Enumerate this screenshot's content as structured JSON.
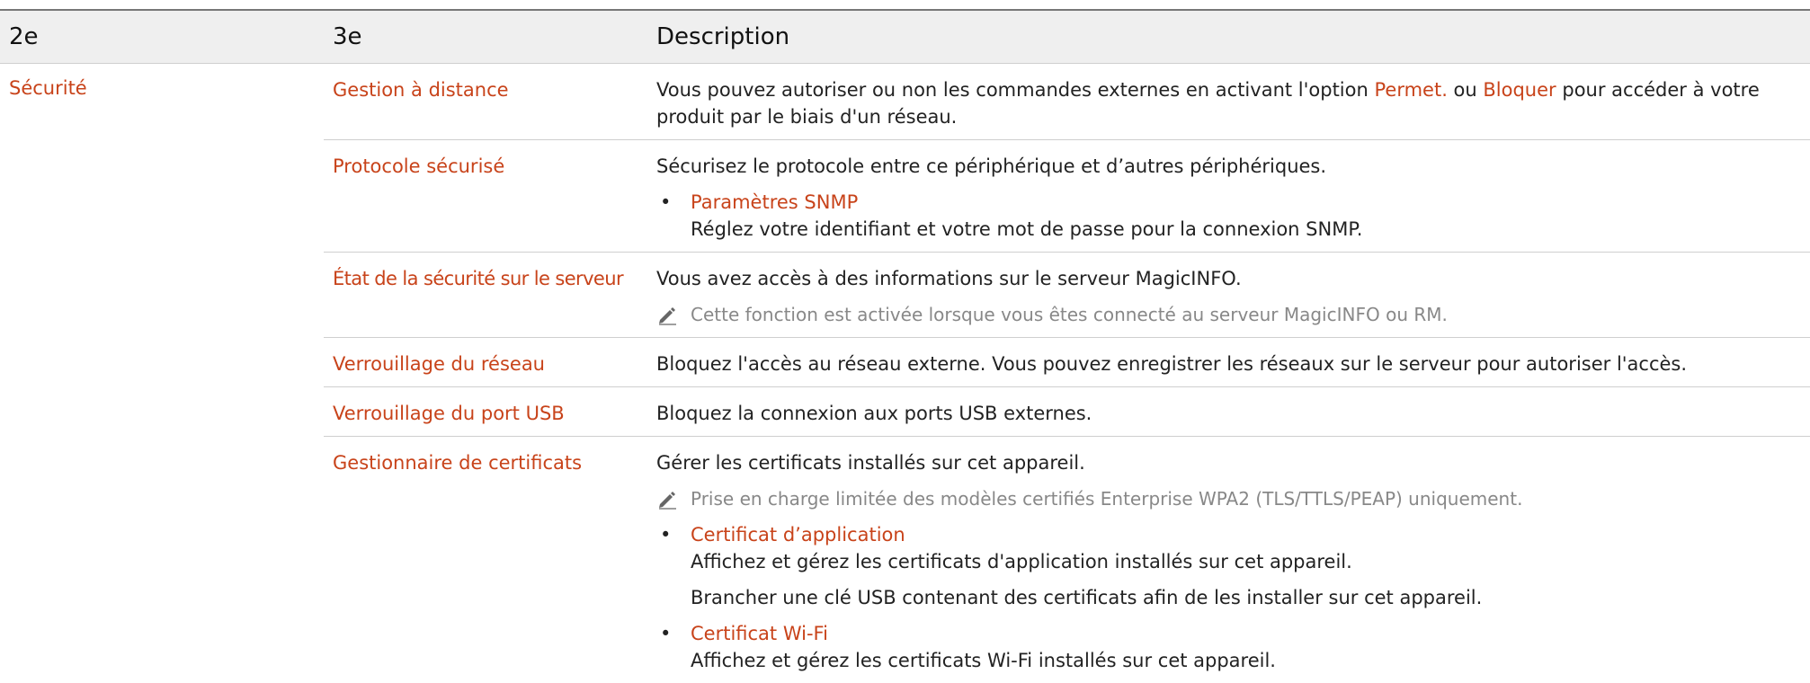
{
  "header": {
    "col1": "2e",
    "col2": "3e",
    "col3": "Description"
  },
  "category": "Sécurité",
  "rows": [
    {
      "name": "Gestion à distance",
      "desc_part1": "Vous pouvez autoriser ou non les commandes externes en activant l'option ",
      "hl1": "Permet.",
      "desc_part2": " ou ",
      "hl2": "Bloquer",
      "desc_part3": " pour accéder à votre produit par le biais d'un réseau."
    },
    {
      "name": "Protocole sécurisé",
      "desc": "Sécurisez le protocole entre ce périphérique et d’autres périphériques.",
      "bullet_title": "Paramètres SNMP",
      "bullet_desc": "Réglez votre identifiant et votre mot de passe pour la connexion SNMP."
    },
    {
      "name": "État de la sécurité sur le serveur",
      "desc": "Vous avez accès à des informations sur le serveur MagicINFO.",
      "note": "Cette fonction est activée lorsque vous êtes connecté au serveur MagicINFO ou RM."
    },
    {
      "name": "Verrouillage du réseau",
      "desc": "Bloquez l'accès au réseau externe. Vous pouvez enregistrer les réseaux sur le serveur pour autoriser l'accès."
    },
    {
      "name": "Verrouillage du port USB",
      "desc": "Bloquez la connexion aux ports USB externes."
    },
    {
      "name": "Gestionnaire de certificats",
      "desc": "Gérer les certificats installés sur cet appareil.",
      "note": "Prise en charge limitée des modèles certifiés Enterprise WPA2 (TLS/TTLS/PEAP) uniquement.",
      "bullets": [
        {
          "title": "Certificat d’application",
          "line1": "Affichez et gérez les certificats d'application installés sur cet appareil.",
          "line2": "Brancher une clé USB contenant des certificats afin de les installer sur cet appareil."
        },
        {
          "title": "Certificat Wi-Fi",
          "line1": "Affichez et gérez les certificats Wi-Fi installés sur cet appareil."
        }
      ]
    }
  ],
  "icons": {
    "note": "pencil-icon"
  },
  "colors": {
    "accent": "#c8431a",
    "header_bg": "#efefef",
    "note_text": "#888888"
  }
}
